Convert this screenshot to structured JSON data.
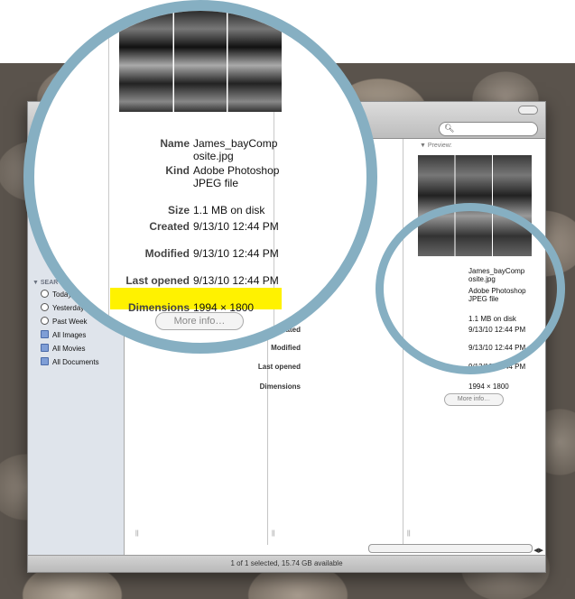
{
  "window": {
    "status_text": "1 of 1 selected, 15.74 GB available"
  },
  "sidebar": {
    "section_header": "SEAR",
    "items": [
      {
        "label": "Today",
        "icon": "clock-icon"
      },
      {
        "label": "Yesterday",
        "icon": "clock-icon"
      },
      {
        "label": "Past Week",
        "icon": "clock-icon"
      },
      {
        "label": "All Images",
        "icon": "smart-folder-icon"
      },
      {
        "label": "All Movies",
        "icon": "smart-folder-icon"
      },
      {
        "label": "All Documents",
        "icon": "smart-folder-icon"
      }
    ]
  },
  "preview": {
    "header": "Preview:",
    "info": [
      {
        "key": "Name",
        "value": "James_bayComposite.jpg"
      },
      {
        "key": "Kind",
        "value": "Adobe Photoshop JPEG file"
      },
      {
        "key": "Size",
        "value": "1.1 MB on disk"
      },
      {
        "key": "Created",
        "value": "9/13/10 12:44 PM"
      },
      {
        "key": "Modified",
        "value": "9/13/10 12:44 PM"
      },
      {
        "key": "Last opened",
        "value": "9/13/10 12:44 PM"
      },
      {
        "key": "Dimensions",
        "value": "1994 × 1800"
      }
    ],
    "more_info_label": "More info…"
  },
  "magnified": {
    "info": [
      {
        "key": "Name",
        "value": "James_bayComposite.jpg"
      },
      {
        "key": "Kind",
        "value": "Adobe Photoshop JPEG file"
      },
      {
        "key": "Size",
        "value": "1.1 MB on disk"
      },
      {
        "key": "Created",
        "value": "9/13/10 12:44 PM"
      },
      {
        "key": "Modified",
        "value": "9/13/10 12:44 PM"
      },
      {
        "key": "Last opened",
        "value": "9/13/10 12:44 PM"
      },
      {
        "key": "Dimensions",
        "value": "1994 × 1800"
      }
    ],
    "more_info_label": "More info…",
    "highlight_color": "#fff200",
    "ring_color": "#86afc2"
  }
}
